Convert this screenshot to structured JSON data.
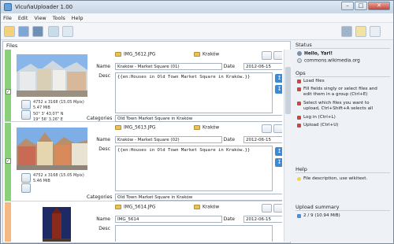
{
  "window": {
    "title": "VicuñaUploader 1.00"
  },
  "menu": [
    "File",
    "Edit",
    "View",
    "Tools",
    "Help"
  ],
  "files_label": "Files",
  "cards": [
    {
      "filename": "IMG_5612.JPG",
      "location": "Kraków",
      "name_label": "Name",
      "name_value": "Kraków - Market Square (01)",
      "date_label": "Date",
      "date_value": "2012-06-15",
      "desc_label": "Desc",
      "desc_value": "{{en:Houses in Old Town Market Square in Kraków.}}",
      "dimensions": "4752 x 3168 (15.05 Mpix)",
      "size": "5.47 MiB",
      "coord_lat": "50° 3' 43.07\" N",
      "coord_lon": "19° 56' 3.26\" E",
      "categories_label": "Categories",
      "categories_value": "Old Town Market Square in Kraków",
      "checked": true,
      "stripe_color": "#8ad07a"
    },
    {
      "filename": "IMG_5613.JPG",
      "location": "Kraków",
      "name_label": "Name",
      "name_value": "Kraków - Market Square (02)",
      "date_label": "Date",
      "date_value": "2012-06-15",
      "desc_label": "Desc",
      "desc_value": "{{en:Houses in Old Town Market Square in Kraków.}}",
      "dimensions": "4752 x 3168 (15.05 Mpix)",
      "size": "5.46 MiB",
      "categories_label": "Categories",
      "categories_value": "Old Town Market Square in Kraków",
      "checked": true,
      "stripe_color": "#8ad07a"
    },
    {
      "filename": "IMG_5614.JPG",
      "location": "Kraków",
      "name_label": "Name",
      "name_value": "IMG_5614",
      "date_label": "Date",
      "date_value": "2012-06-15",
      "desc_label": "Desc",
      "checked": false,
      "stripe_color": "#f5b880"
    }
  ],
  "right": {
    "status_title": "Status",
    "user_greeting": "Hello, Yarl!",
    "site": "commons.wikimedia.org",
    "ops_title": "Ops",
    "ops": [
      "Load files",
      "Fill fields singly or select files and edit them in a group (Ctrl+E)",
      "Select which files you want to upload, Ctrl+Shift+A selects all",
      "Log in (Ctrl+L)",
      "Upload (Ctrl+U)"
    ],
    "help_title": "Help",
    "help_text": "File description, use wikitext.",
    "summary_title": "Upload summary",
    "summary_text": "2 / 9 (10.94 MiB)"
  },
  "colors": {
    "accent": "#3a8ad8",
    "ok": "#8ad07a",
    "pending": "#f5b880"
  }
}
